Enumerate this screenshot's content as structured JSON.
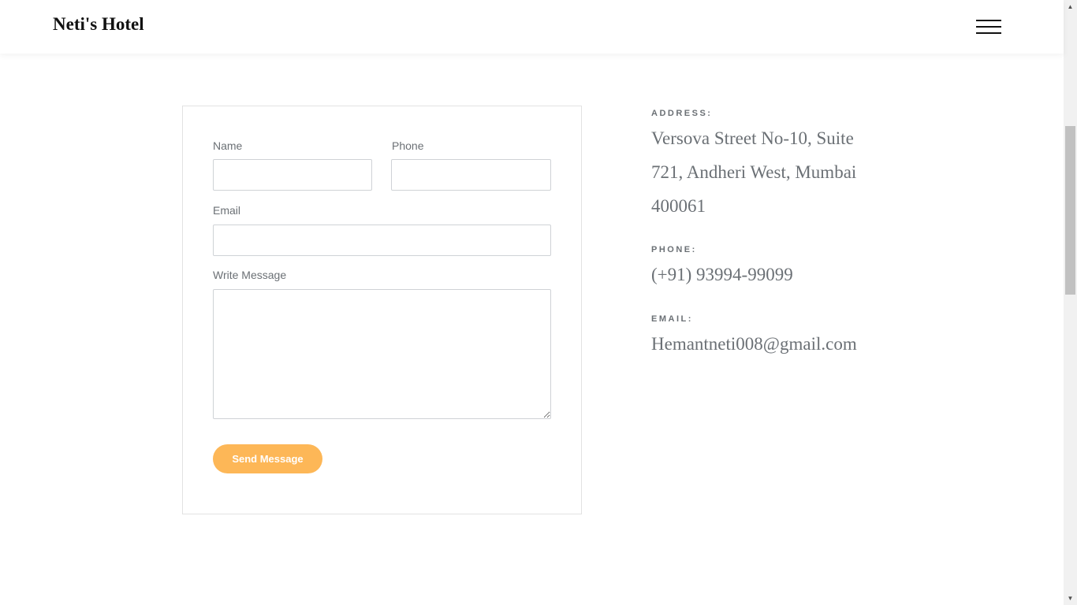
{
  "header": {
    "brand": "Neti's Hotel",
    "menu_icon": "hamburger-menu-icon"
  },
  "form": {
    "name_label": "Name",
    "name_value": "",
    "phone_label": "Phone",
    "phone_value": "",
    "email_label": "Email",
    "email_value": "",
    "message_label": "Write Message",
    "message_value": "",
    "submit_label": "Send Message",
    "submit_color": "#fdb757"
  },
  "contact_info": {
    "address_title": "ADDRESS:",
    "address_line1": "Versova Street No-10, Suite",
    "address_line2": "721, Andheri West, Mumbai",
    "address_line3": "400061",
    "phone_title": "PHONE:",
    "phone_value": "(+91) 93994-99099",
    "email_title": "EMAIL:",
    "email_value": "Hemantneti008@gmail.com"
  }
}
